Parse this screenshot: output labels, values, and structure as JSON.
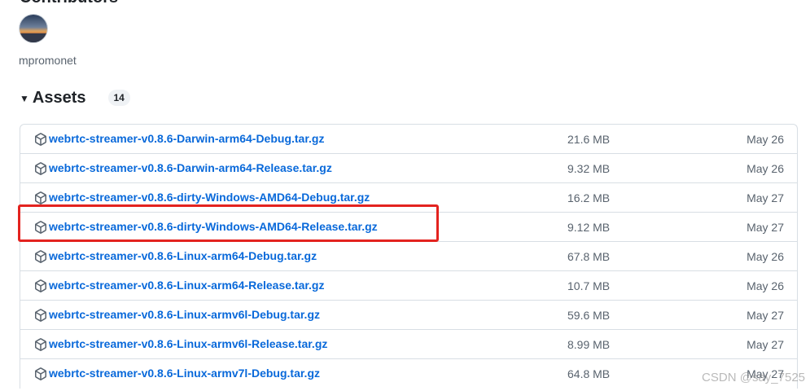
{
  "contributors": {
    "title": "Contributors",
    "users": [
      {
        "username": "mpromonet"
      }
    ]
  },
  "assets": {
    "title": "Assets",
    "count": "14",
    "items": [
      {
        "name": "webrtc-streamer-v0.8.6-Darwin-arm64-Debug.tar.gz",
        "size": "21.6 MB",
        "date": "May 26"
      },
      {
        "name": "webrtc-streamer-v0.8.6-Darwin-arm64-Release.tar.gz",
        "size": "9.32 MB",
        "date": "May 26"
      },
      {
        "name": "webrtc-streamer-v0.8.6-dirty-Windows-AMD64-Debug.tar.gz",
        "size": "16.2 MB",
        "date": "May 27"
      },
      {
        "name": "webrtc-streamer-v0.8.6-dirty-Windows-AMD64-Release.tar.gz",
        "size": "9.12 MB",
        "date": "May 27"
      },
      {
        "name": "webrtc-streamer-v0.8.6-Linux-arm64-Debug.tar.gz",
        "size": "67.8 MB",
        "date": "May 26"
      },
      {
        "name": "webrtc-streamer-v0.8.6-Linux-arm64-Release.tar.gz",
        "size": "10.7 MB",
        "date": "May 26"
      },
      {
        "name": "webrtc-streamer-v0.8.6-Linux-armv6l-Debug.tar.gz",
        "size": "59.6 MB",
        "date": "May 27"
      },
      {
        "name": "webrtc-streamer-v0.8.6-Linux-armv6l-Release.tar.gz",
        "size": "8.99 MB",
        "date": "May 27"
      },
      {
        "name": "webrtc-streamer-v0.8.6-Linux-armv7l-Debug.tar.gz",
        "size": "64.8 MB",
        "date": "May 27"
      }
    ]
  },
  "watermark": "CSDN @say_7525",
  "colors": {
    "link": "#0969da",
    "muted": "#59636e",
    "highlight": "#e3231f"
  },
  "icons": {
    "asset": "package-icon",
    "toggle": "triangle-down-icon"
  }
}
